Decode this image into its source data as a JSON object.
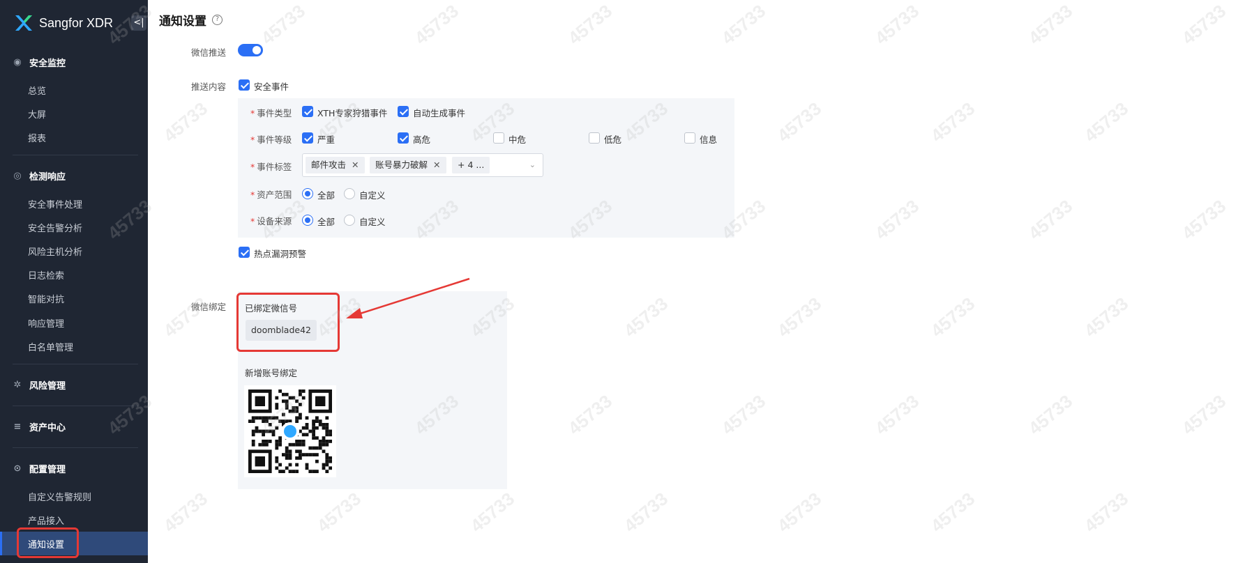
{
  "brand": {
    "name": "Sangfor XDR",
    "collapse_glyph": "<|"
  },
  "sidebar": {
    "groups": [
      {
        "label": "安全监控",
        "icon": "monitor-icon",
        "items": [
          "总览",
          "大屏",
          "报表"
        ]
      },
      {
        "label": "检测响应",
        "icon": "radar-icon",
        "items": [
          "安全事件处理",
          "安全告警分析",
          "风险主机分析",
          "日志检索",
          "智能对抗",
          "响应管理",
          "白名单管理"
        ]
      },
      {
        "label": "风险管理",
        "icon": "risk-icon",
        "items": []
      },
      {
        "label": "资产中心",
        "icon": "database-icon",
        "items": []
      },
      {
        "label": "配置管理",
        "icon": "gear-icon",
        "items": [
          "自定义告警规则",
          "产品接入",
          "通知设置"
        ]
      }
    ],
    "active_item": "通知设置"
  },
  "page": {
    "title": "通知设置",
    "help_glyph": "?",
    "wechat_push_label": "微信推送",
    "wechat_push_enabled": true,
    "push_content_label": "推送内容",
    "security_event_label": "安全事件",
    "security_event_checked": true,
    "event_type": {
      "label": "事件类型",
      "options": [
        {
          "label": "XTH专家狩猎事件",
          "checked": true
        },
        {
          "label": "自动生成事件",
          "checked": true
        }
      ]
    },
    "event_level": {
      "label": "事件等级",
      "options": [
        {
          "label": "严重",
          "checked": true
        },
        {
          "label": "高危",
          "checked": true
        },
        {
          "label": "中危",
          "checked": false
        },
        {
          "label": "低危",
          "checked": false
        },
        {
          "label": "信息",
          "checked": false
        }
      ]
    },
    "event_tags": {
      "label": "事件标签",
      "tags": [
        "邮件攻击",
        "账号暴力破解"
      ],
      "more": "+ 4 ..."
    },
    "asset_scope": {
      "label": "资产范围",
      "options": [
        "全部",
        "自定义"
      ],
      "selected": "全部"
    },
    "device_source": {
      "label": "设备来源",
      "options": [
        "全部",
        "自定义"
      ],
      "selected": "全部"
    },
    "hot_vuln_label": "热点漏洞预警",
    "hot_vuln_checked": true,
    "wechat_bind_label": "微信绑定",
    "bound_wechat_label": "已绑定微信号",
    "bound_wechat_id": "doomblade42",
    "new_bind_label": "新增账号绑定"
  },
  "watermark_text": "45733",
  "colors": {
    "accent": "#2b6ff5",
    "sidebar_bg": "#1f2633",
    "highlight_red": "#e53935"
  }
}
